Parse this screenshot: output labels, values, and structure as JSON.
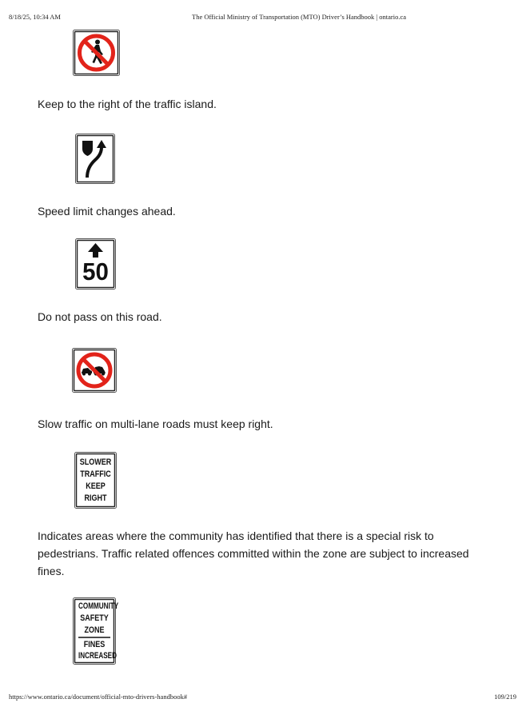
{
  "header": {
    "datetime": "8/18/25, 10:34 AM",
    "title": "The Official Ministry of Transportation (MTO) Driver’s Handbook | ontario.ca"
  },
  "footer": {
    "url": "https://www.ontario.ca/document/official-mto-drivers-handbook#",
    "page": "109/219"
  },
  "captions": [
    "Keep to the right of the traffic island.",
    "Speed limit changes ahead.",
    "Do not pass on this road.",
    "Slow traffic on multi-lane roads must keep right.",
    "Indicates areas where the community has identified that there is a special risk to pedestrians. Traffic related offences committed within the zone are subject to increased fines."
  ],
  "signs": {
    "speed": {
      "number": "50"
    },
    "slower": {
      "lines": [
        "SLOWER",
        "TRAFFIC",
        "KEEP",
        "RIGHT"
      ]
    },
    "community": {
      "top": [
        "COMMUNITY",
        "SAFETY",
        "ZONE"
      ],
      "bottom": [
        "FINES",
        "INCREASED"
      ]
    }
  },
  "colors": {
    "prohibition_red": "#e2231a",
    "sign_black": "#111111"
  }
}
